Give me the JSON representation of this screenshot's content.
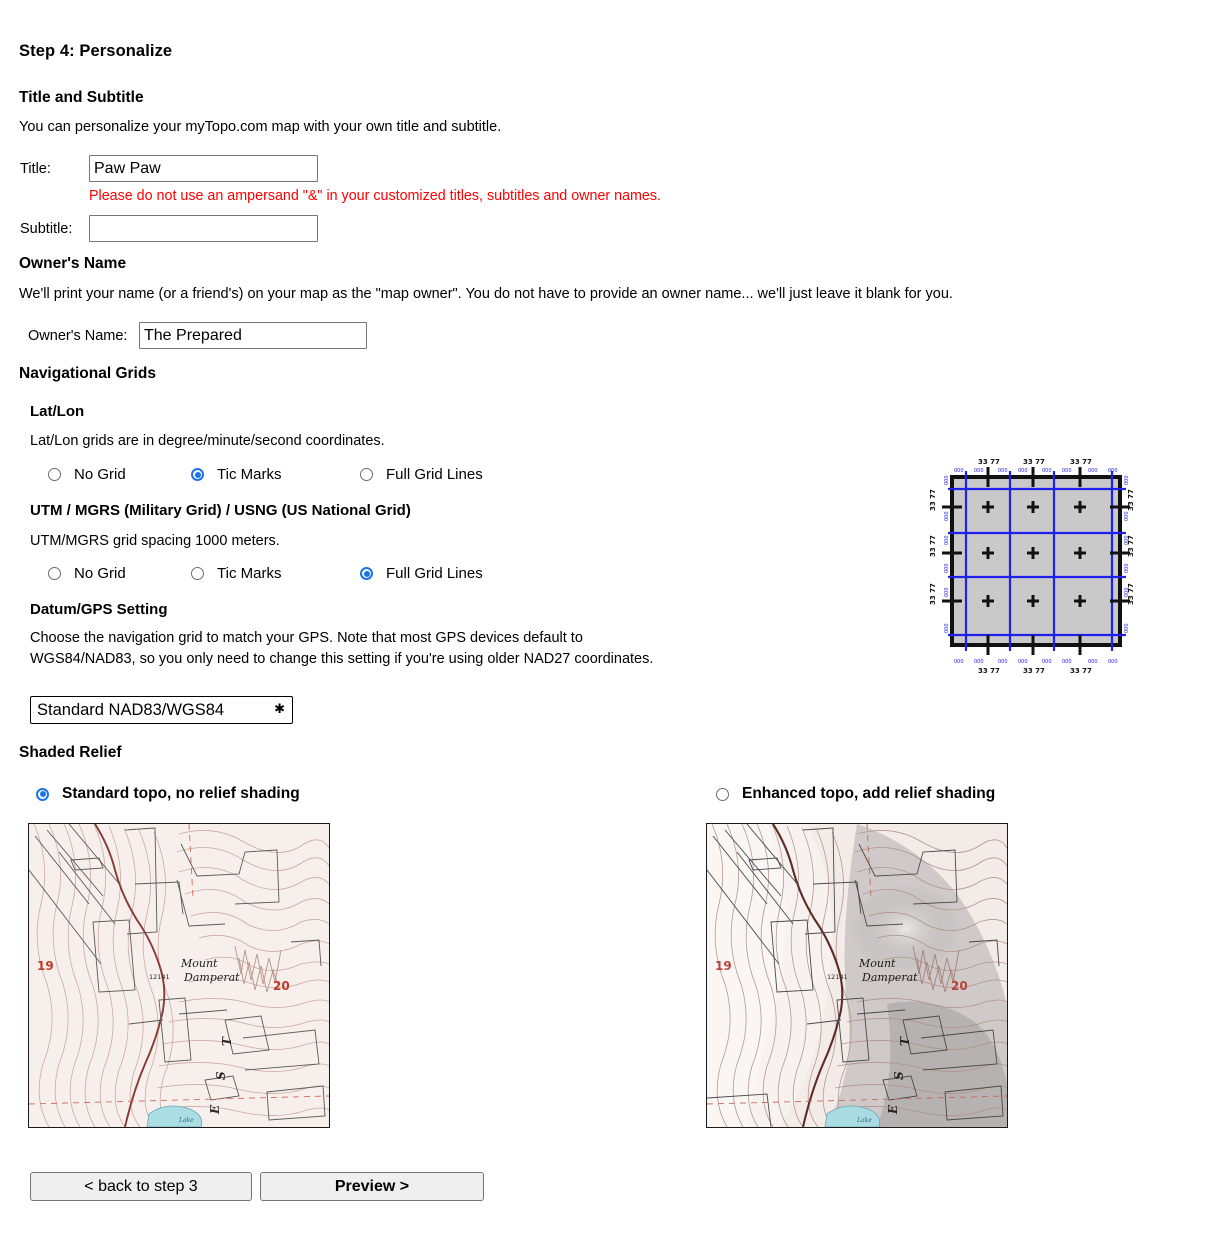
{
  "page": {
    "step_title": "Step 4: Personalize"
  },
  "title_subtitle": {
    "heading": "Title and Subtitle",
    "description": "You can personalize your myTopo.com map with your own title and subtitle.",
    "title_label": "Title:",
    "title_value": "Paw Paw",
    "ampersand_warning": "Please do not use an ampersand \"&\" in your customized titles, subtitles and owner names.",
    "subtitle_label": "Subtitle:",
    "subtitle_value": ""
  },
  "owner": {
    "heading": "Owner's Name",
    "description": "We'll print your name (or a friend's) on your map as the \"map owner\". You do not have to provide an owner name... we'll just leave it blank for you.",
    "label": "Owner's Name:",
    "value": "The Prepared"
  },
  "navigational_grids": {
    "heading": "Navigational Grids",
    "latlon": {
      "heading": "Lat/Lon",
      "description": "Lat/Lon grids are in degree/minute/second coordinates.",
      "options": [
        {
          "label": "No Grid",
          "selected": false
        },
        {
          "label": "Tic Marks",
          "selected": true
        },
        {
          "label": "Full Grid Lines",
          "selected": false
        }
      ]
    },
    "utm": {
      "heading": "UTM / MGRS (Military Grid) / USNG (US National Grid)",
      "description": "UTM/MGRS grid spacing 1000 meters.",
      "options": [
        {
          "label": "No Grid",
          "selected": false
        },
        {
          "label": "Tic Marks",
          "selected": false
        },
        {
          "label": "Full Grid Lines",
          "selected": true
        }
      ]
    },
    "datum": {
      "heading": "Datum/GPS Setting",
      "description": "Choose the navigation grid to match your GPS. Note that most GPS devices default to WGS84/NAD83, so you only need to change this setting if you're using older NAD27 coordinates.",
      "selected": "Standard NAD83/WGS84",
      "options": [
        "Standard NAD83/WGS84"
      ]
    },
    "preview": {
      "name": "grid-preview-diagram",
      "utm_grid_color": "#2020ee",
      "latlon_tic_color": "#111111",
      "map_fill": "#c9c9c9"
    }
  },
  "shaded_relief": {
    "heading": "Shaded Relief",
    "options": [
      {
        "label": "Standard topo, no relief shading",
        "selected": true
      },
      {
        "label": "Enhanced topo, add relief shading",
        "selected": false
      }
    ],
    "map_labels": {
      "peak": "Mount Damperat",
      "elevation": "12141",
      "section_left": "19",
      "section_right": "20",
      "forest_text": "E S T"
    }
  },
  "footer": {
    "back_label": "< back to step 3",
    "preview_label": "Preview >"
  }
}
